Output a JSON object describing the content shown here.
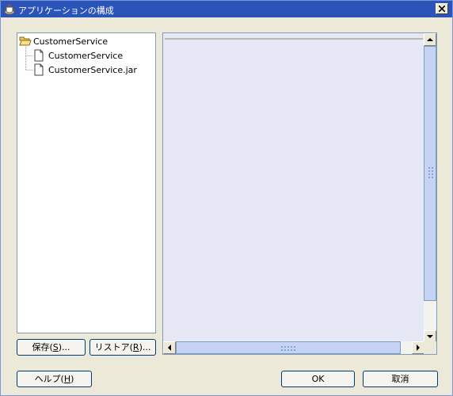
{
  "window": {
    "title": "アプリケーションの構成"
  },
  "tree": {
    "root": {
      "label": "CustomerService",
      "icon": "folder-open-icon"
    },
    "children": [
      {
        "label": "CustomerService",
        "icon": "document-icon"
      },
      {
        "label": "CustomerService.jar",
        "icon": "document-icon"
      }
    ]
  },
  "buttons": {
    "save": {
      "label": "保存(",
      "mnemonic": "S",
      "suffix": ")..."
    },
    "restore": {
      "label": "リストア(",
      "mnemonic": "R",
      "suffix": ")..."
    },
    "help": {
      "label": "ヘルプ(",
      "mnemonic": "H",
      "suffix": ")"
    },
    "ok": {
      "label": "OK"
    },
    "cancel": {
      "label": "取消"
    }
  },
  "colors": {
    "titlebar": "#2b54b8",
    "dialog_bg": "#ece9d8",
    "content_bg": "#e6e9f5",
    "scroll_thumb": "#c5d4f5"
  }
}
